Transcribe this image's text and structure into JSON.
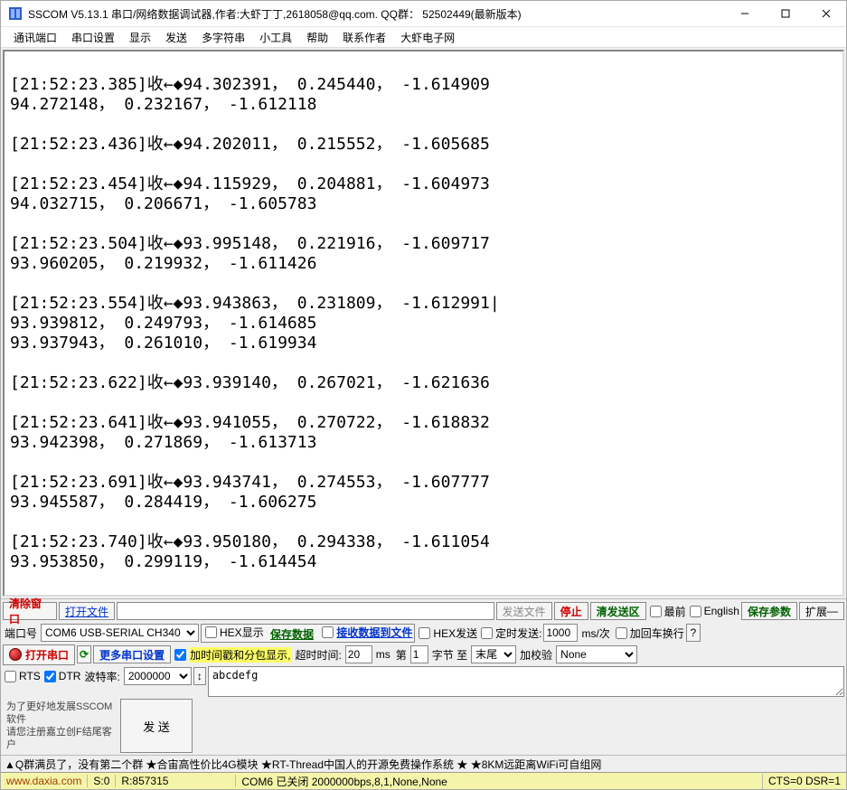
{
  "window": {
    "title": "SSCOM V5.13.1 串口/网络数据调试器,作者:大虾丁丁,2618058@qq.com. QQ群： 52502449(最新版本)"
  },
  "menu": [
    "通讯端口",
    "串口设置",
    "显示",
    "发送",
    "多字符串",
    "小工具",
    "帮助",
    "联系作者",
    "大虾电子网"
  ],
  "log": "\n[21:52:23.385]收←◆94.302391， 0.245440， -1.614909\n94.272148， 0.232167， -1.612118\n\n[21:52:23.436]收←◆94.202011， 0.215552， -1.605685\n\n[21:52:23.454]收←◆94.115929， 0.204881， -1.604973\n94.032715， 0.206671， -1.605783\n\n[21:52:23.504]收←◆93.995148， 0.221916， -1.609717\n93.960205， 0.219932， -1.611426\n\n[21:52:23.554]收←◆93.943863， 0.231809， -1.612991|\n93.939812， 0.249793， -1.614685\n93.937943， 0.261010， -1.619934\n\n[21:52:23.622]收←◆93.939140， 0.267021， -1.621636\n\n[21:52:23.641]收←◆93.941055， 0.270722， -1.618832\n93.942398， 0.271869， -1.613713\n\n[21:52:23.691]收←◆93.943741， 0.274553， -1.607777\n93.945587， 0.284419， -1.606275\n\n[21:52:23.740]收←◆93.950180， 0.294338， -1.611054\n93.953850， 0.299119， -1.614454\n",
  "toolbar1": {
    "clear": "清除窗口",
    "openfile": "打开文件",
    "sendfile": "发送文件",
    "stop": "停止",
    "clearsend": "清发送区",
    "topmost": "最前",
    "english": "English",
    "saveparam": "保存参数",
    "extend": "扩展"
  },
  "toolbar2": {
    "port_label": "端口号",
    "port_value": "COM6 USB-SERIAL CH340",
    "hexshow": "HEX显示",
    "savedata": "保存数据",
    "rxfile": "接收数据到文件",
    "hexsend": "HEX发送",
    "timed": "定时发送:",
    "interval": "1000",
    "interval_unit": "ms/次",
    "crlf": "加回车换行"
  },
  "toolbar3": {
    "openport": "打开串口",
    "moresettings": "更多串口设置",
    "timestamp": "加时间戳和分包显示,",
    "timeout_label": "超时时间:",
    "timeout": "20",
    "ms": "ms",
    "frame_label": "第",
    "frame_n": "1",
    "frame_mid": "字节 至",
    "frame_end": "末尾",
    "check_label": "加校验",
    "check_value": "None"
  },
  "toolbar4": {
    "rts": "RTS",
    "dtr": "DTR",
    "baud_label": "波特率:",
    "baud": "2000000",
    "send_text": "abcdefg"
  },
  "sidebox": {
    "line1": "为了更好地发展SSCOM软件",
    "line2": "请您注册嘉立创F结尾客户"
  },
  "sendbtn": "发  送",
  "promo": "▲Q群满员了，没有第二个群  ★合宙高性价比4G模块  ★RT-Thread中国人的开源免费操作系统  ★ ★8KM远距离WiFi可自组网",
  "status": {
    "url": "www.daxia.com",
    "S": "S:0",
    "R": "R:857315",
    "com": "COM6 已关闭  2000000bps,8,1,None,None",
    "cts": "CTS=0 DSR=1"
  }
}
